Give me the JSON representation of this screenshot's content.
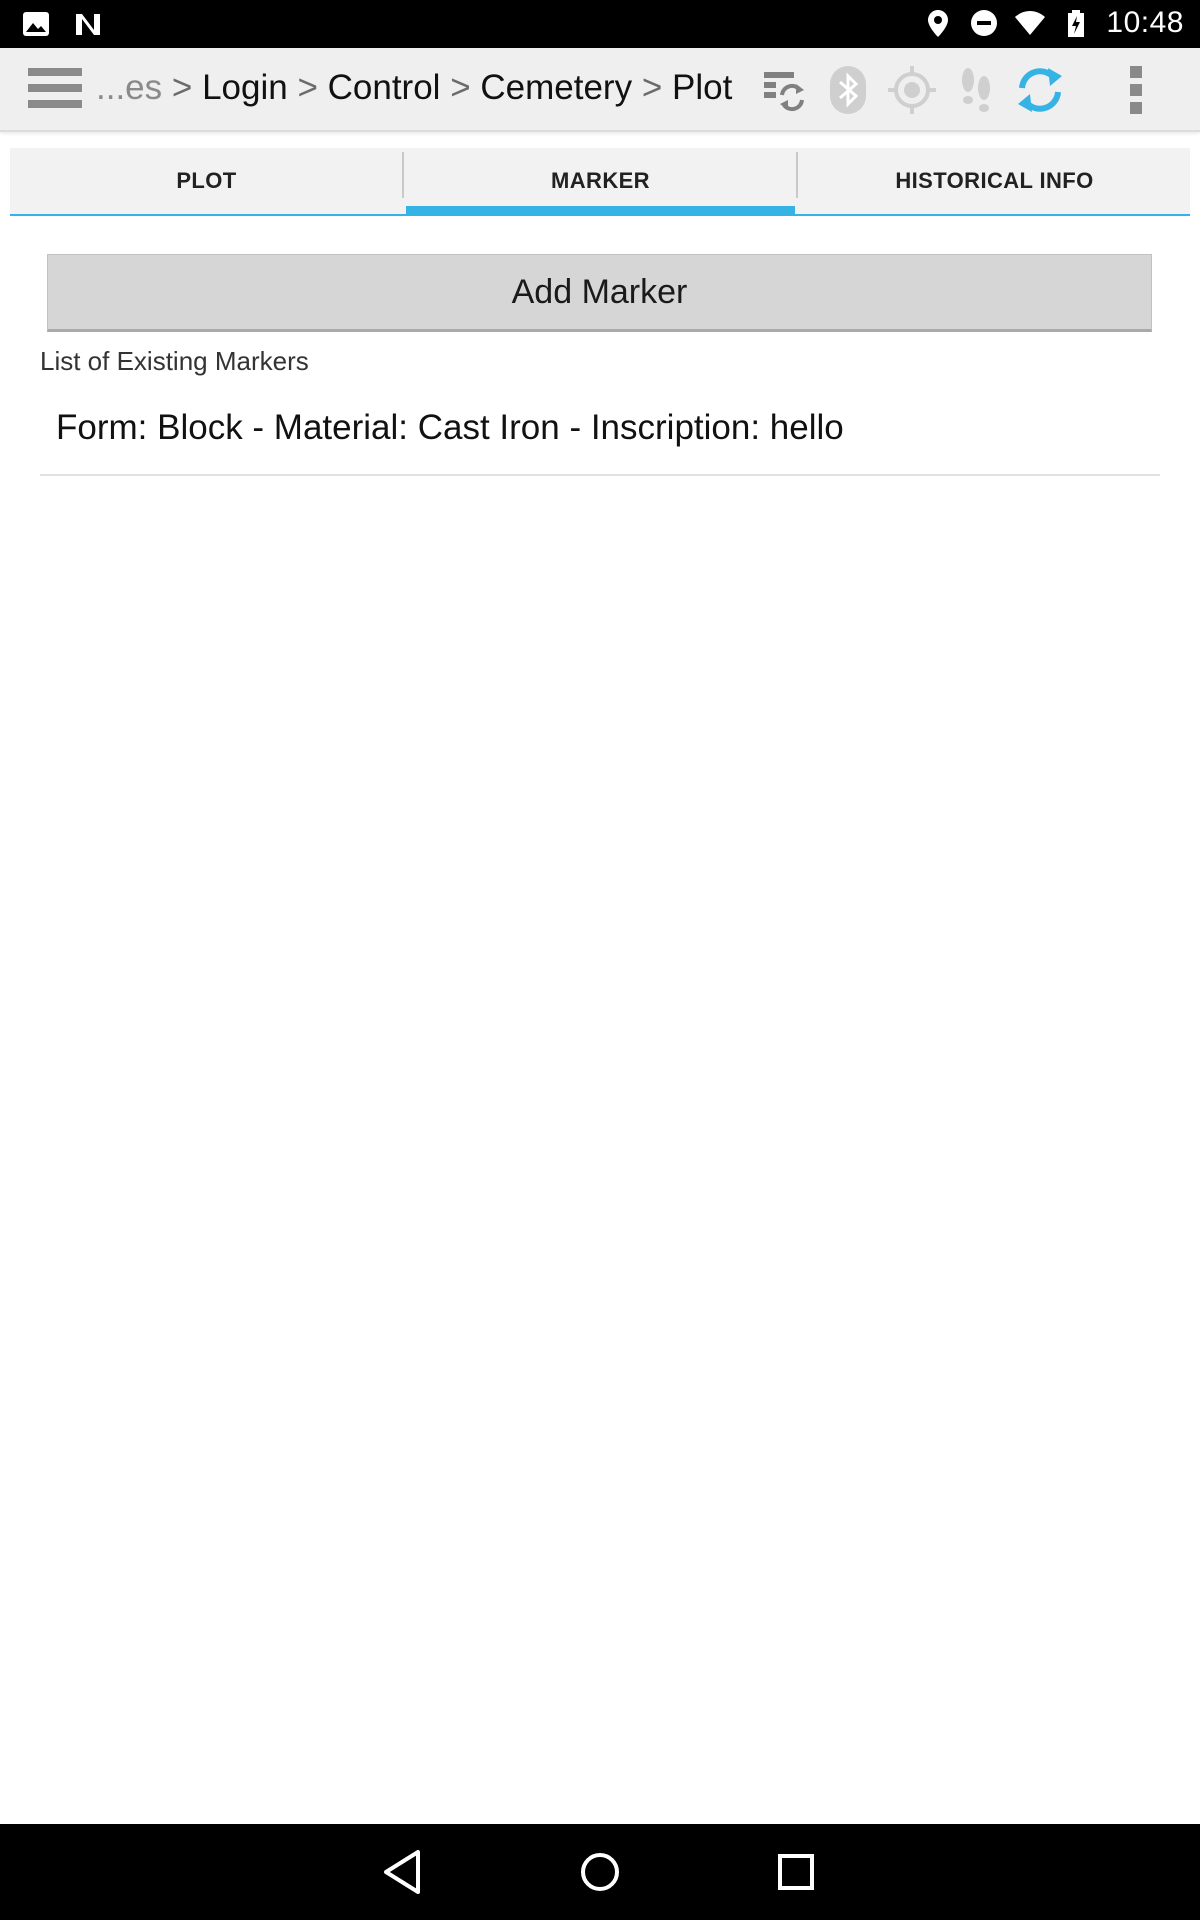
{
  "status_bar": {
    "time": "10:48",
    "left_icons": [
      "image-icon",
      "n-logo-icon"
    ],
    "right_icons": [
      "location-icon",
      "do-not-disturb-icon",
      "wifi-icon",
      "battery-icon"
    ]
  },
  "action_bar": {
    "menu_icon": "hamburger-icon",
    "breadcrumb": {
      "ellipsis": "...es",
      "separator": ">",
      "items": [
        "Login",
        "Control",
        "Cemetery",
        "Plot"
      ]
    },
    "icons": [
      "sync-data-icon",
      "bluetooth-icon",
      "gps-target-icon",
      "footsteps-icon",
      "refresh-icon",
      "overflow-menu-icon"
    ],
    "accent_color": "#35b3e4"
  },
  "tabs": [
    {
      "label": "PLOT",
      "active": false
    },
    {
      "label": "MARKER",
      "active": true
    },
    {
      "label": "HISTORICAL INFO",
      "active": false
    }
  ],
  "main": {
    "add_button_label": "Add Marker",
    "list_heading": "List of Existing Markers",
    "markers": [
      {
        "text": "Form: Block - Material: Cast Iron - Inscription: hello"
      }
    ]
  },
  "nav_bar": {
    "icons": [
      "back-icon",
      "home-icon",
      "recents-icon"
    ]
  }
}
